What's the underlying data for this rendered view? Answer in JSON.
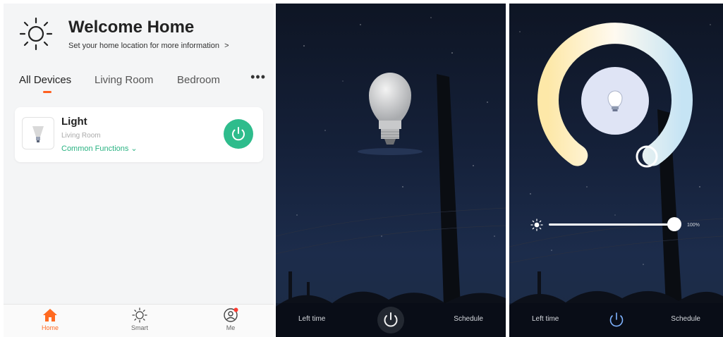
{
  "home": {
    "title": "Welcome Home",
    "subtitle": "Set your home location for more information",
    "subtitle_chevron": ">",
    "tabs": [
      {
        "label": "All Devices",
        "active": true
      },
      {
        "label": "Living Room",
        "active": false
      },
      {
        "label": "Bedroom",
        "active": false
      }
    ],
    "more": "•••",
    "device": {
      "name": "Light",
      "room": "Living Room",
      "functions": "Common Functions ⌄",
      "power_color": "#2ebc8c"
    },
    "tabbar": [
      {
        "label": "Home",
        "icon": "home-icon",
        "active": true
      },
      {
        "label": "Smart",
        "icon": "sun-icon",
        "active": false
      },
      {
        "label": "Me",
        "icon": "profile-icon",
        "active": false
      }
    ],
    "accent_color": "#ff6a21"
  },
  "control": {
    "left_time": "Left time",
    "schedule": "Schedule"
  },
  "color_temp": {
    "left_time": "Left time",
    "schedule": "Schedule",
    "brightness_value": "100%",
    "brightness_fraction": 1.0,
    "ring_colors": [
      "#fdecb0",
      "#fffbe8",
      "#cbe6f4"
    ]
  }
}
